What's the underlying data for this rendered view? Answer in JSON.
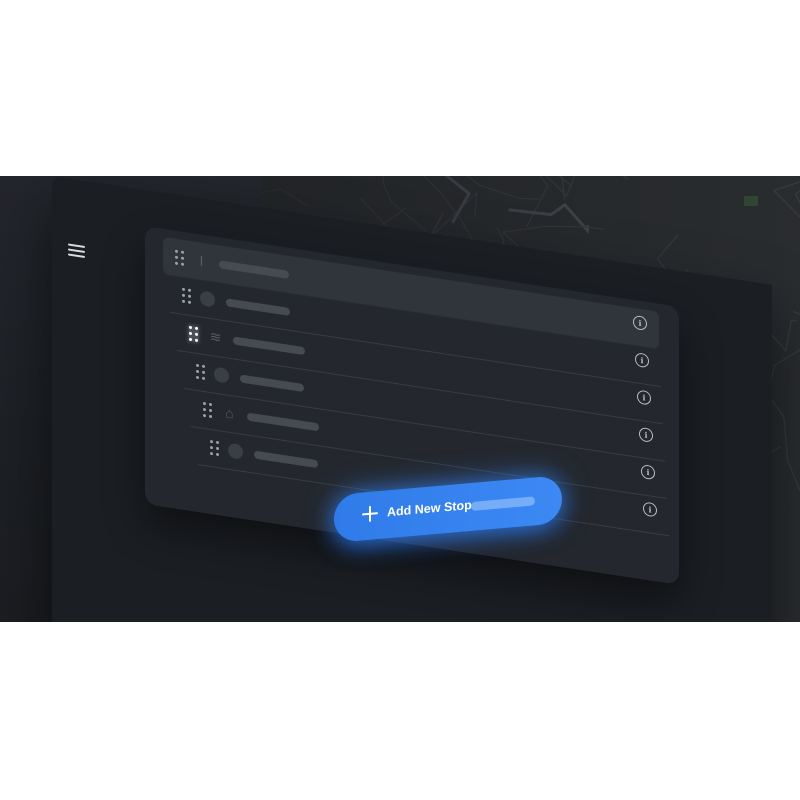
{
  "app": {
    "menu_icon": "hamburger-menu-icon",
    "colors": {
      "background": "#1d2025",
      "panel": "#24272d",
      "row_selected": "#30343b",
      "accent": "#3c89f4",
      "map": "#2a2d30",
      "map_green": "#2f4a33"
    }
  },
  "stops": [
    {
      "icon": "text-cursor-icon",
      "glyph": "I",
      "selected": true,
      "handle_active": false
    },
    {
      "icon": "circle-icon",
      "glyph": "",
      "selected": false,
      "handle_active": false
    },
    {
      "icon": "layers-icon",
      "glyph": "≋",
      "selected": false,
      "handle_active": true
    },
    {
      "icon": "circle-icon",
      "glyph": "",
      "selected": false,
      "handle_active": false
    },
    {
      "icon": "map-pin-icon",
      "glyph": "⌂",
      "selected": false,
      "handle_active": false
    },
    {
      "icon": "circle-icon",
      "glyph": "",
      "selected": false,
      "handle_active": false
    }
  ],
  "info_icon": "info-icon",
  "info_glyph": "i",
  "add_button": {
    "label": "Add New Stop",
    "icon": "plus-icon"
  }
}
